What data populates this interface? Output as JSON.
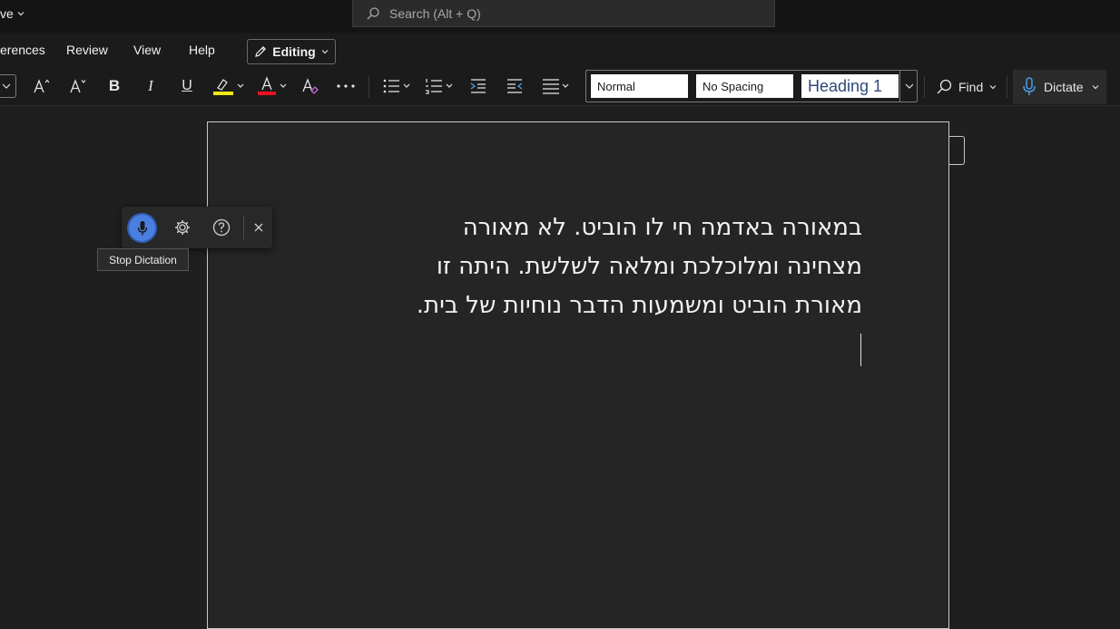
{
  "titlebar": {
    "save_state": "ve",
    "search": {
      "placeholder": "Search (Alt + Q)"
    }
  },
  "tabs": {
    "references": "erences",
    "review": "Review",
    "view": "View",
    "help": "Help",
    "editing": "Editing"
  },
  "ribbon": {
    "bold": "B",
    "italic": "I",
    "underline": "U",
    "styles": {
      "normal": "Normal",
      "no_spacing": "No Spacing",
      "heading1": "Heading 1"
    },
    "find": "Find",
    "dictate": "Dictate",
    "colors": {
      "highlight": "#f2e51c",
      "font_color": "#e81123",
      "accent": "#4a7fe0"
    }
  },
  "document": {
    "lines": [
      "במאורה באדמה חי לו הוביט. לא מאורה",
      "מצחינה ומלוכלכת ומלאה לשלשת. היתה זו",
      "מאורת הוביט ומשמעות הדבר נוחיות של בית."
    ]
  },
  "dictation": {
    "tooltip": "Stop Dictation",
    "icons": [
      "microphone-icon",
      "gear-icon",
      "help-icon",
      "close-icon"
    ]
  }
}
